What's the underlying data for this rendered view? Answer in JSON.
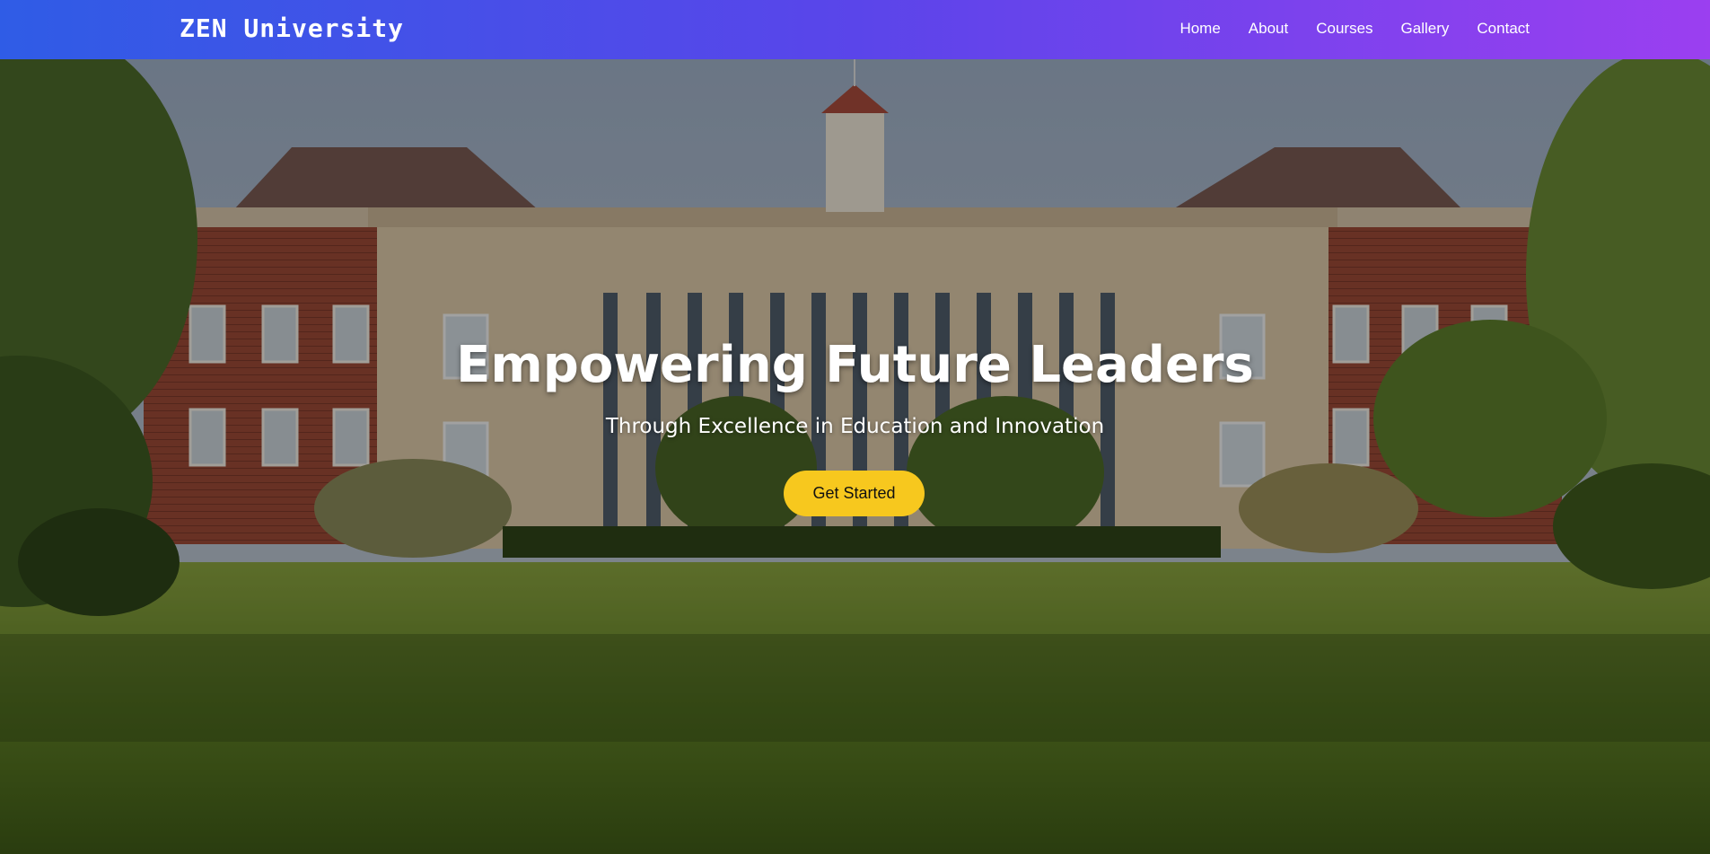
{
  "brand": {
    "name": "ZEN University"
  },
  "nav": {
    "items": [
      {
        "label": "Home"
      },
      {
        "label": "About"
      },
      {
        "label": "Courses"
      },
      {
        "label": "Gallery"
      },
      {
        "label": "Contact"
      }
    ]
  },
  "hero": {
    "title": "Empowering Future Leaders",
    "subtitle": "Through Excellence in Education and Innovation",
    "cta_label": "Get Started",
    "background_image": "university-campus-building"
  },
  "colors": {
    "nav_gradient_start": "#2f5ce6",
    "nav_gradient_end": "#9b3ff0",
    "cta_background": "#f7c81e",
    "text_light": "#ffffff"
  }
}
